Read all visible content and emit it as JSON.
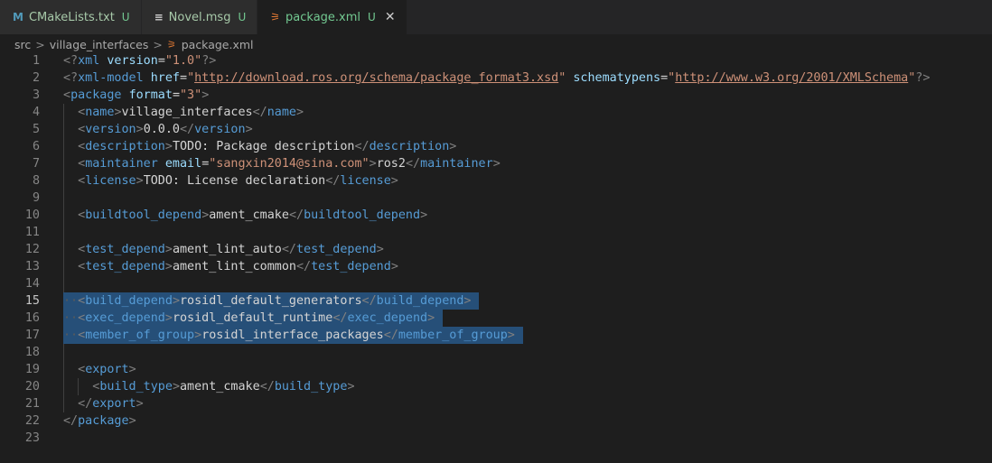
{
  "tabs": [
    {
      "icon": "M",
      "name": "CMakeLists.txt",
      "status": "U",
      "active": false,
      "icon_color": "#519aba"
    },
    {
      "icon": "≡",
      "name": "Novel.msg",
      "status": "U",
      "active": false,
      "icon_color": "#cccccc"
    },
    {
      "icon": "⚞",
      "name": "package.xml",
      "status": "U",
      "active": true,
      "icon_color": "#e37933",
      "close": "✕"
    }
  ],
  "breadcrumb": [
    "src",
    "village_interfaces",
    "package.xml"
  ],
  "breadcrumb_sep": ">",
  "colors": {
    "tag": "#569cd6",
    "punct": "#808080",
    "attr": "#9cdcfe",
    "string": "#ce9178",
    "text": "#d4d4d4",
    "selection": "#264f78"
  },
  "current_line": 15,
  "lines": [
    {
      "n": "1",
      "tokens": [
        [
          "p",
          "<?"
        ],
        [
          "g",
          "xml"
        ],
        [
          "t",
          " "
        ],
        [
          "a",
          "version"
        ],
        [
          "t",
          "="
        ],
        [
          "s",
          "\"1.0\""
        ],
        [
          "p",
          "?>"
        ]
      ]
    },
    {
      "n": "2",
      "tokens": [
        [
          "p",
          "<?"
        ],
        [
          "g",
          "xml-model"
        ],
        [
          "t",
          " "
        ],
        [
          "a",
          "href"
        ],
        [
          "t",
          "="
        ],
        [
          "s",
          "\""
        ],
        [
          "u",
          "http://download.ros.org/schema/package_format3.xsd"
        ],
        [
          "s",
          "\""
        ],
        [
          "t",
          " "
        ],
        [
          "a",
          "schematypens"
        ],
        [
          "t",
          "="
        ],
        [
          "s",
          "\""
        ],
        [
          "u",
          "http://www.w3.org/2001/XMLSchema"
        ],
        [
          "s",
          "\""
        ],
        [
          "p",
          "?>"
        ]
      ]
    },
    {
      "n": "3",
      "tokens": [
        [
          "p",
          "<"
        ],
        [
          "g",
          "package"
        ],
        [
          "t",
          " "
        ],
        [
          "a",
          "format"
        ],
        [
          "t",
          "="
        ],
        [
          "s",
          "\"3\""
        ],
        [
          "p",
          ">"
        ]
      ]
    },
    {
      "n": "4",
      "indent": 1,
      "tokens": [
        [
          "p",
          "<"
        ],
        [
          "g",
          "name"
        ],
        [
          "p",
          ">"
        ],
        [
          "t",
          "village_interfaces"
        ],
        [
          "p",
          "</"
        ],
        [
          "g",
          "name"
        ],
        [
          "p",
          ">"
        ]
      ]
    },
    {
      "n": "5",
      "indent": 1,
      "tokens": [
        [
          "p",
          "<"
        ],
        [
          "g",
          "version"
        ],
        [
          "p",
          ">"
        ],
        [
          "t",
          "0.0.0"
        ],
        [
          "p",
          "</"
        ],
        [
          "g",
          "version"
        ],
        [
          "p",
          ">"
        ]
      ]
    },
    {
      "n": "6",
      "indent": 1,
      "tokens": [
        [
          "p",
          "<"
        ],
        [
          "g",
          "description"
        ],
        [
          "p",
          ">"
        ],
        [
          "t",
          "TODO: Package description"
        ],
        [
          "p",
          "</"
        ],
        [
          "g",
          "description"
        ],
        [
          "p",
          ">"
        ]
      ]
    },
    {
      "n": "7",
      "indent": 1,
      "tokens": [
        [
          "p",
          "<"
        ],
        [
          "g",
          "maintainer"
        ],
        [
          "t",
          " "
        ],
        [
          "a",
          "email"
        ],
        [
          "t",
          "="
        ],
        [
          "s",
          "\"sangxin2014@sina.com\""
        ],
        [
          "p",
          ">"
        ],
        [
          "t",
          "ros2"
        ],
        [
          "p",
          "</"
        ],
        [
          "g",
          "maintainer"
        ],
        [
          "p",
          ">"
        ]
      ]
    },
    {
      "n": "8",
      "indent": 1,
      "tokens": [
        [
          "p",
          "<"
        ],
        [
          "g",
          "license"
        ],
        [
          "p",
          ">"
        ],
        [
          "t",
          "TODO: License declaration"
        ],
        [
          "p",
          "</"
        ],
        [
          "g",
          "license"
        ],
        [
          "p",
          ">"
        ]
      ]
    },
    {
      "n": "9",
      "indent": 1,
      "tokens": []
    },
    {
      "n": "10",
      "indent": 1,
      "tokens": [
        [
          "p",
          "<"
        ],
        [
          "g",
          "buildtool_depend"
        ],
        [
          "p",
          ">"
        ],
        [
          "t",
          "ament_cmake"
        ],
        [
          "p",
          "</"
        ],
        [
          "g",
          "buildtool_depend"
        ],
        [
          "p",
          ">"
        ]
      ]
    },
    {
      "n": "11",
      "indent": 1,
      "tokens": []
    },
    {
      "n": "12",
      "indent": 1,
      "tokens": [
        [
          "p",
          "<"
        ],
        [
          "g",
          "test_depend"
        ],
        [
          "p",
          ">"
        ],
        [
          "t",
          "ament_lint_auto"
        ],
        [
          "p",
          "</"
        ],
        [
          "g",
          "test_depend"
        ],
        [
          "p",
          ">"
        ]
      ]
    },
    {
      "n": "13",
      "indent": 1,
      "tokens": [
        [
          "p",
          "<"
        ],
        [
          "g",
          "test_depend"
        ],
        [
          "p",
          ">"
        ],
        [
          "t",
          "ament_lint_common"
        ],
        [
          "p",
          "</"
        ],
        [
          "g",
          "test_depend"
        ],
        [
          "p",
          ">"
        ]
      ]
    },
    {
      "n": "14",
      "indent": 1,
      "tokens": []
    },
    {
      "n": "15",
      "indent": 1,
      "selected": true,
      "tokens": [
        [
          "p",
          "<"
        ],
        [
          "g",
          "build_depend"
        ],
        [
          "p",
          ">"
        ],
        [
          "t",
          "rosidl_default_generators"
        ],
        [
          "p",
          "</"
        ],
        [
          "g",
          "build_depend"
        ],
        [
          "p",
          ">"
        ]
      ]
    },
    {
      "n": "16",
      "indent": 1,
      "selected": true,
      "tokens": [
        [
          "p",
          "<"
        ],
        [
          "g",
          "exec_depend"
        ],
        [
          "p",
          ">"
        ],
        [
          "t",
          "rosidl_default_runtime"
        ],
        [
          "p",
          "</"
        ],
        [
          "g",
          "exec_depend"
        ],
        [
          "p",
          ">"
        ]
      ]
    },
    {
      "n": "17",
      "indent": 1,
      "selected": true,
      "tokens": [
        [
          "p",
          "<"
        ],
        [
          "g",
          "member_of_group"
        ],
        [
          "p",
          ">"
        ],
        [
          "t",
          "rosidl_interface_packages"
        ],
        [
          "p",
          "</"
        ],
        [
          "g",
          "member_of_group"
        ],
        [
          "p",
          ">"
        ]
      ]
    },
    {
      "n": "18",
      "indent": 1,
      "tokens": []
    },
    {
      "n": "19",
      "indent": 1,
      "tokens": [
        [
          "p",
          "<"
        ],
        [
          "g",
          "export"
        ],
        [
          "p",
          ">"
        ]
      ]
    },
    {
      "n": "20",
      "indent": 2,
      "tokens": [
        [
          "p",
          "<"
        ],
        [
          "g",
          "build_type"
        ],
        [
          "p",
          ">"
        ],
        [
          "t",
          "ament_cmake"
        ],
        [
          "p",
          "</"
        ],
        [
          "g",
          "build_type"
        ],
        [
          "p",
          ">"
        ]
      ]
    },
    {
      "n": "21",
      "indent": 1,
      "tokens": [
        [
          "p",
          "</"
        ],
        [
          "g",
          "export"
        ],
        [
          "p",
          ">"
        ]
      ]
    },
    {
      "n": "22",
      "tokens": [
        [
          "p",
          "</"
        ],
        [
          "g",
          "package"
        ],
        [
          "p",
          ">"
        ]
      ]
    },
    {
      "n": "23",
      "tokens": []
    }
  ]
}
